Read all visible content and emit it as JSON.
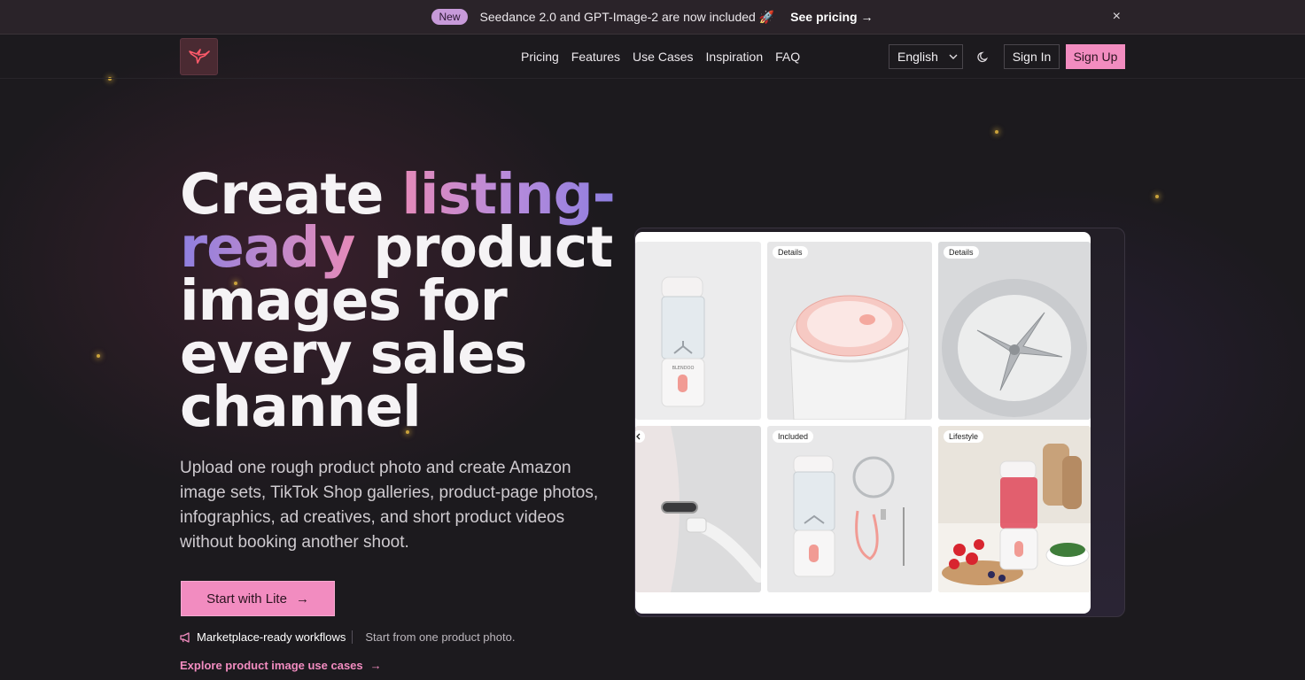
{
  "announcement": {
    "badge": "New",
    "text": "Seedance 2.0 and GPT-Image-2 are now included 🚀",
    "link": "See pricing",
    "link_arrow": "→",
    "close": "×"
  },
  "nav": {
    "links": [
      "Pricing",
      "Features",
      "Use Cases",
      "Inspiration",
      "FAQ"
    ],
    "language": "English",
    "sign_in": "Sign In",
    "sign_up": "Sign Up"
  },
  "hero": {
    "headline_part1": "Create ",
    "headline_highlight1": "listing-",
    "headline_highlight2": "ready",
    "headline_part2": " product images for every sales channel",
    "subheadline": "Upload one rough product photo and create Amazon image sets, TikTok Shop galleries, product-page photos, infographics, ad creatives, and short product videos without booking another shoot.",
    "cta": "Start with Lite",
    "cta_arrow": "→",
    "feature_primary": "Marketplace-ready workflows",
    "feature_secondary": "Start from one product photo.",
    "explore_link": "Explore product image use cases",
    "explore_arrow": "→"
  },
  "gallery": {
    "labels": [
      "Details",
      "Details",
      "Included",
      "Lifestyle"
    ],
    "product_brand": "BLENDOO"
  },
  "colors": {
    "accent": "#f28cc0",
    "background": "#1c1a1e",
    "gradient_start": "#e58ab9",
    "gradient_end": "#8e7fe0"
  }
}
